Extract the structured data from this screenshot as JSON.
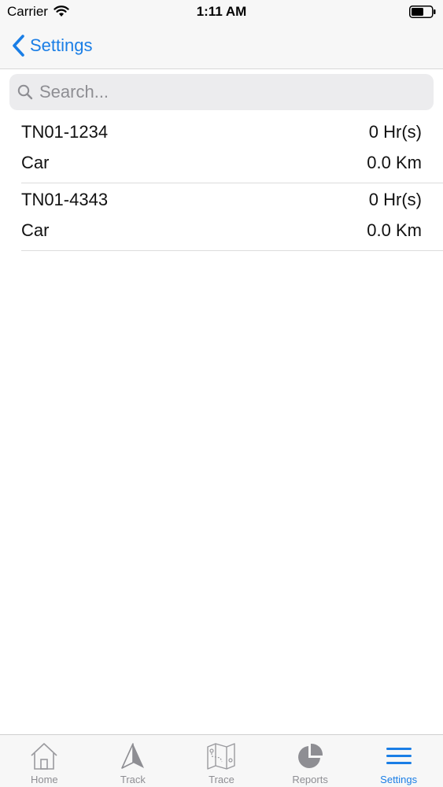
{
  "status_bar": {
    "carrier": "Carrier",
    "time": "1:11 AM"
  },
  "nav": {
    "back_label": "Settings"
  },
  "search": {
    "placeholder": "Search...",
    "value": ""
  },
  "vehicles": [
    {
      "number": "TN01-1234",
      "hours": "0 Hr(s)",
      "type": "Car",
      "distance": "0.0 Km"
    },
    {
      "number": "TN01-4343",
      "hours": "0 Hr(s)",
      "type": "Car",
      "distance": "0.0 Km"
    }
  ],
  "tabs": [
    {
      "label": "Home",
      "icon": "home-icon",
      "active": false
    },
    {
      "label": "Track",
      "icon": "navigation-arrow-icon",
      "active": false
    },
    {
      "label": "Trace",
      "icon": "map-icon",
      "active": false
    },
    {
      "label": "Reports",
      "icon": "pie-chart-icon",
      "active": false
    },
    {
      "label": "Settings",
      "icon": "menu-icon",
      "active": true
    }
  ],
  "colors": {
    "accent": "#1a7ee6",
    "inactive": "#8e8e93",
    "bar_background": "#f7f7f7"
  }
}
